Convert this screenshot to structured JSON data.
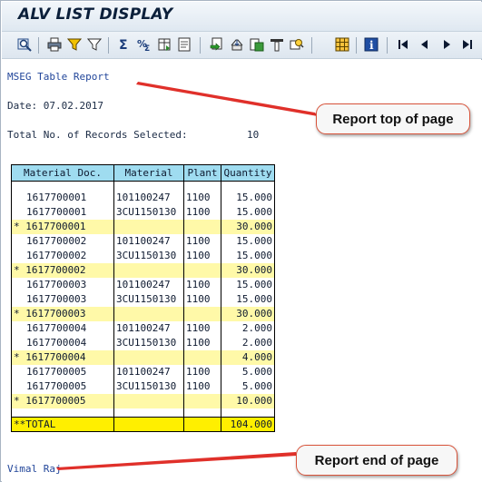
{
  "window": {
    "title": "ALV LIST DISPLAY"
  },
  "toolbar": {
    "icons": [
      "details-icon",
      "print-icon",
      "filter-icon",
      "filter-settings-icon",
      "sum-icon",
      "subtotal-icon",
      "export-icon",
      "word-icon",
      "local-file-icon",
      "mail-icon",
      "sort-ascending-icon",
      "sort-descending-icon",
      "find-icon",
      "layout-icon",
      "info-icon",
      "first-page-icon",
      "previous-page-icon",
      "next-page-icon",
      "last-page-icon"
    ]
  },
  "report": {
    "heading": "MSEG Table Report",
    "date_line": "Date: 07.02.2017",
    "count_label": "Total No. of Records Selected:",
    "count_value": "10",
    "footer": "Vimal Raj"
  },
  "table": {
    "headers": [
      "Material Doc.",
      "Material",
      "Plant",
      "Quantity"
    ],
    "rows": [
      {
        "type": "item",
        "doc": "1617700001",
        "material": "101100247",
        "plant": "1100",
        "qty": "15.000"
      },
      {
        "type": "item",
        "doc": "1617700001",
        "material": "3CU1150130",
        "plant": "1100",
        "qty": "15.000"
      },
      {
        "type": "subtotal",
        "doc": "* 1617700001",
        "material": "",
        "plant": "",
        "qty": "30.000"
      },
      {
        "type": "item",
        "doc": "1617700002",
        "material": "101100247",
        "plant": "1100",
        "qty": "15.000"
      },
      {
        "type": "item",
        "doc": "1617700002",
        "material": "3CU1150130",
        "plant": "1100",
        "qty": "15.000"
      },
      {
        "type": "subtotal",
        "doc": "* 1617700002",
        "material": "",
        "plant": "",
        "qty": "30.000"
      },
      {
        "type": "item",
        "doc": "1617700003",
        "material": "101100247",
        "plant": "1100",
        "qty": "15.000"
      },
      {
        "type": "item",
        "doc": "1617700003",
        "material": "3CU1150130",
        "plant": "1100",
        "qty": "15.000"
      },
      {
        "type": "subtotal",
        "doc": "* 1617700003",
        "material": "",
        "plant": "",
        "qty": "30.000"
      },
      {
        "type": "item",
        "doc": "1617700004",
        "material": "101100247",
        "plant": "1100",
        "qty": "2.000"
      },
      {
        "type": "item",
        "doc": "1617700004",
        "material": "3CU1150130",
        "plant": "1100",
        "qty": "2.000"
      },
      {
        "type": "subtotal",
        "doc": "* 1617700004",
        "material": "",
        "plant": "",
        "qty": "4.000"
      },
      {
        "type": "item",
        "doc": "1617700005",
        "material": "101100247",
        "plant": "1100",
        "qty": "5.000"
      },
      {
        "type": "item",
        "doc": "1617700005",
        "material": "3CU1150130",
        "plant": "1100",
        "qty": "5.000"
      },
      {
        "type": "subtotal",
        "doc": "* 1617700005",
        "material": "",
        "plant": "",
        "qty": "10.000"
      }
    ],
    "total": {
      "label": "**TOTAL",
      "qty": "104.000"
    }
  },
  "annotations": {
    "top": "Report top of page",
    "end": "Report end of page",
    "arrow_color": "#e0302a"
  },
  "colors": {
    "header_cyan": "#9fdcf0",
    "subtotal_yellow": "#fff9a8",
    "total_yellow": "#ffef00"
  }
}
